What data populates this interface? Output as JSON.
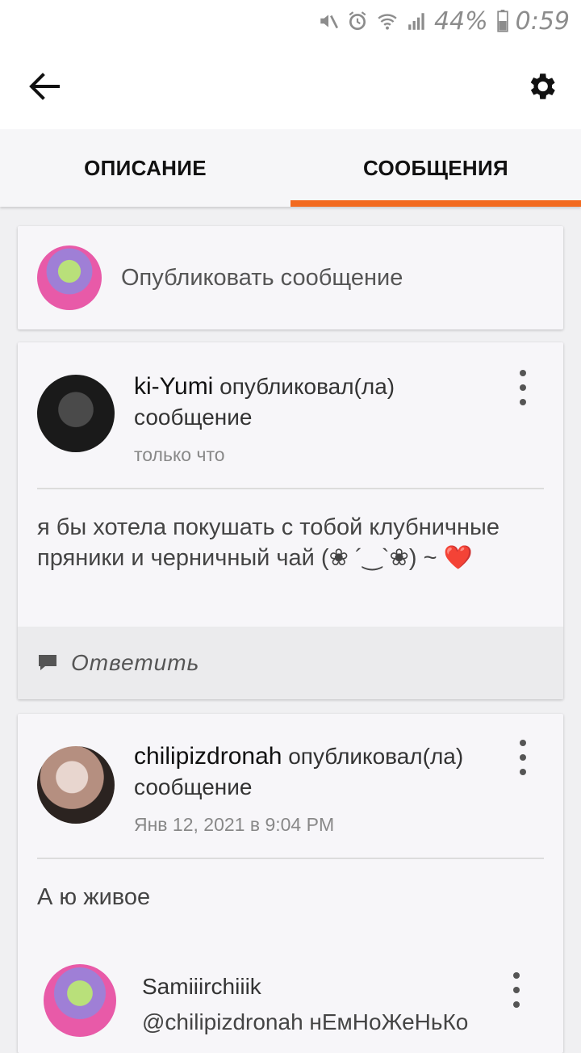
{
  "status_bar": {
    "battery": "44%",
    "time": "0:59"
  },
  "tabs": [
    {
      "label": "ОПИСАНИЕ"
    },
    {
      "label": "СООБЩЕНИЯ"
    }
  ],
  "compose": {
    "placeholder": "Опубликовать сообщение"
  },
  "posts": [
    {
      "user": "ki-Yumi",
      "verb": "опубликовал(ла)",
      "object": "сообщение",
      "time": "только что",
      "body": "я бы хотела покушать с тобой клубничные пряники и черничный чай (❀ ´‿`❀) ~ ❤️",
      "reply_label": "Ответить"
    },
    {
      "user": "chilipizdronah",
      "verb": "опубликовал(ла)",
      "object": "сообщение",
      "time": "Янв 12, 2021 в 9:04 PM",
      "body": "А ю живое"
    }
  ],
  "reply": {
    "user": "Samiiirchiiik",
    "text": "@chilipizdronah нЕмНоЖеНьКо"
  },
  "colors": {
    "accent": "#f26a1f"
  },
  "icons": [
    "mute-icon",
    "alarm-icon",
    "wifi-icon",
    "signal-icon",
    "battery-icon",
    "back-arrow-icon",
    "gear-icon",
    "more-vert-icon",
    "comment-icon"
  ]
}
